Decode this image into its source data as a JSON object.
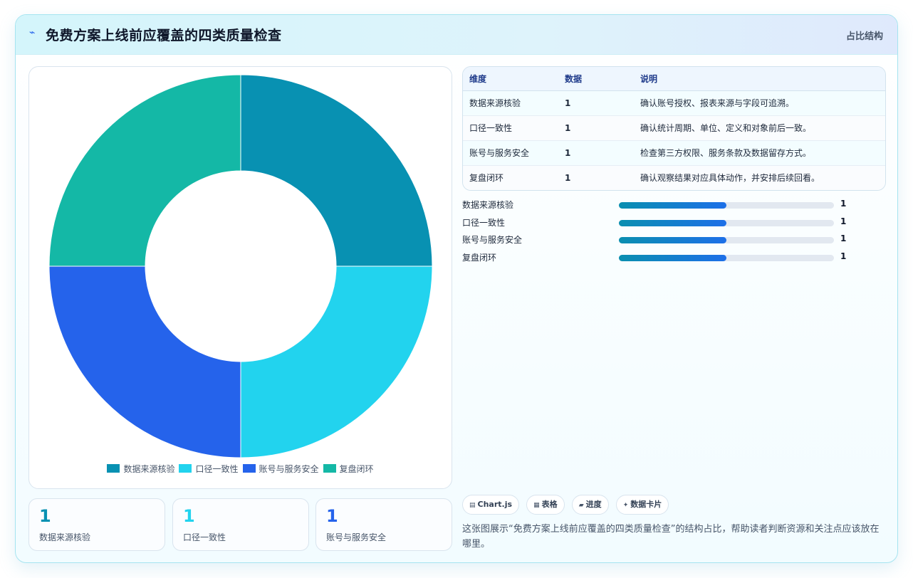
{
  "header": {
    "logo_glyph": "⌁",
    "title": "免费方案上线前应覆盖的四类质量检查",
    "badge": "占比结构"
  },
  "chart_data": {
    "type": "pie",
    "variant": "doughnut",
    "categories": [
      "数据来源核验",
      "口径一致性",
      "账号与服务安全",
      "复盘闭环"
    ],
    "values": [
      1,
      1,
      1,
      1
    ],
    "colors": [
      "#0891b2",
      "#22d3ee",
      "#2563eb",
      "#14b8a6"
    ],
    "legend_position": "bottom"
  },
  "kpis": [
    {
      "value": "1",
      "label": "数据来源核验",
      "color": "#0891b2"
    },
    {
      "value": "1",
      "label": "口径一致性",
      "color": "#22d3ee"
    },
    {
      "value": "1",
      "label": "账号与服务安全",
      "color": "#2563eb"
    }
  ],
  "table": {
    "headers": [
      "维度",
      "数据",
      "说明"
    ],
    "rows": [
      [
        "数据来源核验",
        "1",
        "确认账号授权、报表来源与字段可追溯。"
      ],
      [
        "口径一致性",
        "1",
        "确认统计周期、单位、定义和对象前后一致。"
      ],
      [
        "账号与服务安全",
        "1",
        "检查第三方权限、服务条款及数据留存方式。"
      ],
      [
        "复盘闭环",
        "1",
        "确认观察结果对应具体动作，并安排后续回看。"
      ]
    ]
  },
  "progress": {
    "max": 2,
    "items": [
      {
        "label": "数据来源核验",
        "value": 1,
        "value_text": "1"
      },
      {
        "label": "口径一致性",
        "value": 1,
        "value_text": "1"
      },
      {
        "label": "账号与服务安全",
        "value": 1,
        "value_text": "1"
      },
      {
        "label": "复盘闭环",
        "value": 1,
        "value_text": "1"
      }
    ]
  },
  "chips": [
    {
      "icon": "▤",
      "icon_name": "chart-icon",
      "label": "Chart.js"
    },
    {
      "icon": "▦",
      "icon_name": "table-icon",
      "label": "表格"
    },
    {
      "icon": "▰",
      "icon_name": "progress-icon",
      "label": "进度"
    },
    {
      "icon": "✦",
      "icon_name": "sparkle-icon",
      "label": "数据卡片"
    }
  ],
  "description": "这张图展示“免费方案上线前应覆盖的四类质量检查”的结构占比，帮助读者判断资源和关注点应该放在哪里。"
}
